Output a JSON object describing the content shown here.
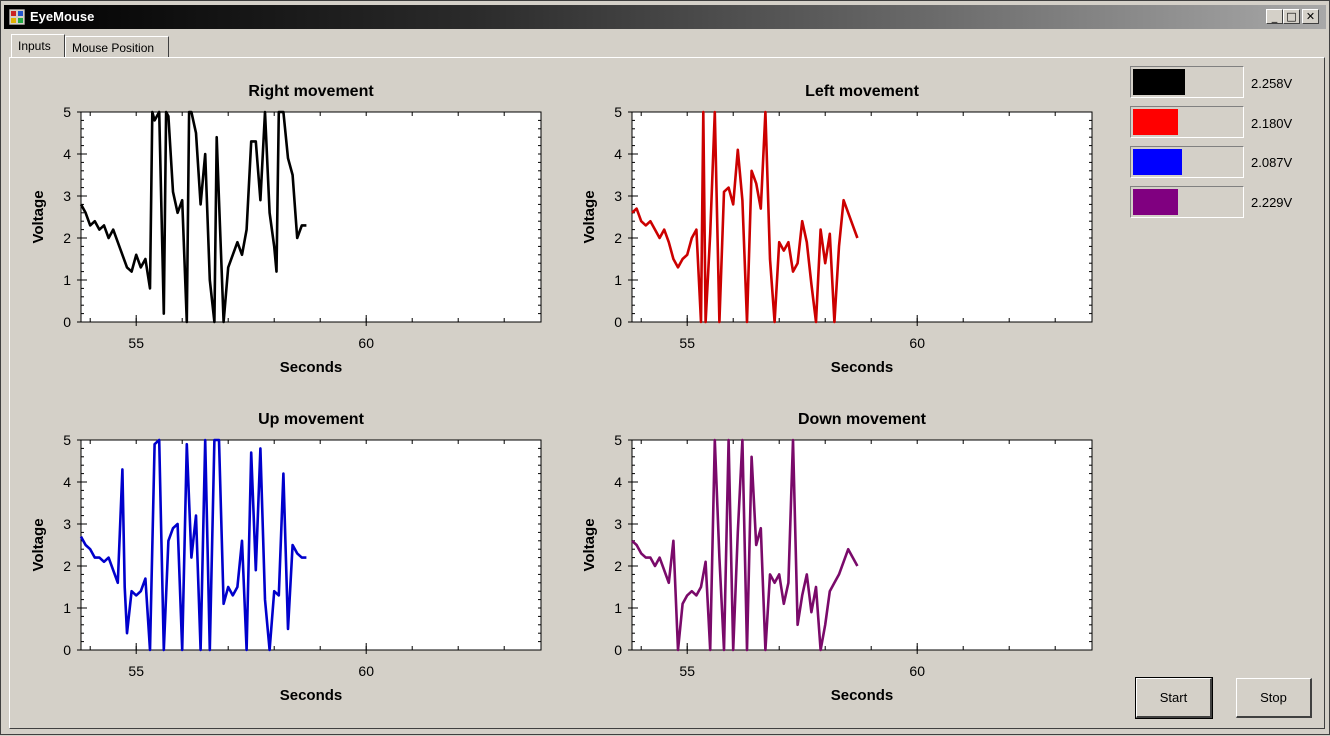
{
  "window": {
    "title": "EyeMouse",
    "minimize_glyph": "_",
    "maximize_glyph": "□",
    "close_glyph": "✕"
  },
  "tabs": [
    {
      "label": "Inputs",
      "selected": true
    },
    {
      "label": "Mouse Position",
      "selected": false
    }
  ],
  "meters": [
    {
      "color": "#000000",
      "level": 0.48,
      "value_label": "2.258V"
    },
    {
      "color": "#ff0000",
      "level": 0.42,
      "value_label": "2.180V"
    },
    {
      "color": "#0000ff",
      "level": 0.45,
      "value_label": "2.087V"
    },
    {
      "color": "#800080",
      "level": 0.42,
      "value_label": "2.229V"
    }
  ],
  "buttons": {
    "start": "Start",
    "stop": "Stop"
  },
  "chart_data": [
    {
      "type": "line",
      "title": "Right movement",
      "xlabel": "Seconds",
      "ylabel": "Voltage",
      "xlim": [
        53.8,
        63.8
      ],
      "ylim": [
        0,
        5
      ],
      "xticks": [
        55,
        60
      ],
      "yticks": [
        0,
        1,
        2,
        3,
        4,
        5
      ],
      "grid": false,
      "color": "#000000",
      "series": [
        {
          "x": [
            53.8,
            53.9,
            54.0,
            54.1,
            54.2,
            54.3,
            54.4,
            54.5,
            54.6,
            54.7,
            54.8,
            54.9,
            55.0,
            55.1,
            55.2,
            55.3,
            55.35,
            55.4,
            55.5,
            55.6,
            55.65,
            55.7,
            55.8,
            55.9,
            56.0,
            56.1,
            56.15,
            56.2,
            56.3,
            56.4,
            56.5,
            56.6,
            56.7,
            56.75,
            56.8,
            56.9,
            57.0,
            57.1,
            57.2,
            57.3,
            57.4,
            57.5,
            57.6,
            57.7,
            57.8,
            57.9,
            58.0,
            58.05,
            58.1,
            58.2,
            58.3,
            58.4,
            58.5,
            58.6,
            58.7
          ],
          "y": [
            2.8,
            2.6,
            2.3,
            2.4,
            2.2,
            2.3,
            2.0,
            2.2,
            1.9,
            1.6,
            1.3,
            1.2,
            1.6,
            1.3,
            1.5,
            0.8,
            5.0,
            4.8,
            5.0,
            0.2,
            5.0,
            4.9,
            3.1,
            2.6,
            2.9,
            0.0,
            5.0,
            5.0,
            4.5,
            2.8,
            4.0,
            1.0,
            0.0,
            4.4,
            2.9,
            0.0,
            1.3,
            1.6,
            1.9,
            1.6,
            2.2,
            4.3,
            4.3,
            2.9,
            5.0,
            2.6,
            1.8,
            1.2,
            5.0,
            5.0,
            3.9,
            3.5,
            2.0,
            2.3,
            2.3
          ]
        }
      ]
    },
    {
      "type": "line",
      "title": "Left movement",
      "xlabel": "Seconds",
      "ylabel": "Voltage",
      "xlim": [
        53.8,
        63.8
      ],
      "ylim": [
        0,
        5
      ],
      "xticks": [
        55,
        60
      ],
      "yticks": [
        0,
        1,
        2,
        3,
        4,
        5
      ],
      "grid": false,
      "color": "#cc0000",
      "series": [
        {
          "x": [
            53.8,
            53.9,
            54.0,
            54.1,
            54.2,
            54.3,
            54.4,
            54.5,
            54.6,
            54.7,
            54.8,
            54.9,
            55.0,
            55.1,
            55.2,
            55.3,
            55.35,
            55.4,
            55.5,
            55.6,
            55.7,
            55.8,
            55.9,
            56.0,
            56.1,
            56.2,
            56.3,
            56.4,
            56.5,
            56.6,
            56.7,
            56.8,
            56.9,
            57.0,
            57.1,
            57.2,
            57.3,
            57.4,
            57.5,
            57.6,
            57.7,
            57.8,
            57.9,
            58.0,
            58.1,
            58.2,
            58.3,
            58.4,
            58.5,
            58.6,
            58.7
          ],
          "y": [
            2.6,
            2.7,
            2.4,
            2.3,
            2.4,
            2.2,
            2.0,
            2.2,
            1.9,
            1.5,
            1.3,
            1.5,
            1.6,
            2.0,
            2.2,
            0.0,
            5.0,
            0.0,
            2.1,
            5.0,
            0.0,
            3.1,
            3.2,
            2.8,
            4.1,
            2.9,
            0.0,
            3.6,
            3.3,
            2.7,
            5.0,
            1.5,
            0.0,
            1.9,
            1.7,
            1.9,
            1.2,
            1.4,
            2.4,
            1.9,
            0.9,
            0.0,
            2.2,
            1.4,
            2.1,
            0.0,
            1.8,
            2.9,
            2.6,
            2.3,
            2.0
          ]
        }
      ]
    },
    {
      "type": "line",
      "title": "Up movement",
      "xlabel": "Seconds",
      "ylabel": "Voltage",
      "xlim": [
        53.8,
        63.8
      ],
      "ylim": [
        0,
        5
      ],
      "xticks": [
        55,
        60
      ],
      "yticks": [
        0,
        1,
        2,
        3,
        4,
        5
      ],
      "grid": false,
      "color": "#0000cc",
      "series": [
        {
          "x": [
            53.8,
            53.9,
            54.0,
            54.1,
            54.2,
            54.3,
            54.4,
            54.5,
            54.6,
            54.7,
            54.75,
            54.8,
            54.9,
            55.0,
            55.1,
            55.2,
            55.3,
            55.4,
            55.5,
            55.6,
            55.7,
            55.8,
            55.9,
            56.0,
            56.1,
            56.2,
            56.3,
            56.4,
            56.5,
            56.6,
            56.7,
            56.8,
            56.9,
            57.0,
            57.1,
            57.2,
            57.3,
            57.4,
            57.5,
            57.6,
            57.7,
            57.8,
            57.9,
            58.0,
            58.1,
            58.2,
            58.3,
            58.4,
            58.5,
            58.6,
            58.7
          ],
          "y": [
            2.7,
            2.5,
            2.4,
            2.2,
            2.2,
            2.1,
            2.2,
            1.9,
            1.6,
            4.3,
            1.5,
            0.4,
            1.4,
            1.3,
            1.4,
            1.7,
            0.0,
            4.9,
            5.0,
            0.0,
            2.6,
            2.9,
            3.0,
            0.0,
            4.9,
            2.2,
            3.2,
            0.0,
            5.0,
            0.0,
            5.0,
            5.0,
            1.1,
            1.5,
            1.3,
            1.5,
            2.6,
            0.0,
            4.7,
            1.9,
            4.8,
            1.2,
            0.0,
            1.4,
            1.3,
            4.2,
            0.5,
            2.5,
            2.3,
            2.2,
            2.2
          ]
        }
      ]
    },
    {
      "type": "line",
      "title": "Down movement",
      "xlabel": "Seconds",
      "ylabel": "Voltage",
      "xlim": [
        53.8,
        63.8
      ],
      "ylim": [
        0,
        5
      ],
      "xticks": [
        55,
        60
      ],
      "yticks": [
        0,
        1,
        2,
        3,
        4,
        5
      ],
      "grid": false,
      "color": "#7a0a6a",
      "series": [
        {
          "x": [
            53.8,
            53.9,
            54.0,
            54.1,
            54.2,
            54.3,
            54.4,
            54.5,
            54.6,
            54.7,
            54.8,
            54.9,
            55.0,
            55.1,
            55.2,
            55.3,
            55.4,
            55.5,
            55.6,
            55.7,
            55.8,
            55.9,
            56.0,
            56.1,
            56.2,
            56.3,
            56.4,
            56.5,
            56.6,
            56.7,
            56.8,
            56.9,
            57.0,
            57.1,
            57.2,
            57.3,
            57.4,
            57.5,
            57.6,
            57.7,
            57.8,
            57.9,
            58.0,
            58.1,
            58.2,
            58.3,
            58.4,
            58.5,
            58.6,
            58.7
          ],
          "y": [
            2.6,
            2.5,
            2.3,
            2.2,
            2.2,
            2.0,
            2.2,
            1.9,
            1.6,
            2.6,
            0.0,
            1.1,
            1.3,
            1.4,
            1.3,
            1.5,
            2.1,
            0.0,
            5.0,
            2.2,
            0.0,
            5.0,
            0.0,
            2.8,
            5.0,
            0.0,
            4.6,
            2.5,
            2.9,
            0.0,
            1.8,
            1.6,
            1.8,
            1.1,
            1.6,
            5.0,
            0.6,
            1.3,
            1.8,
            0.9,
            1.5,
            0.0,
            0.6,
            1.4,
            1.6,
            1.8,
            2.1,
            2.4,
            2.2,
            2.0
          ]
        }
      ]
    }
  ]
}
